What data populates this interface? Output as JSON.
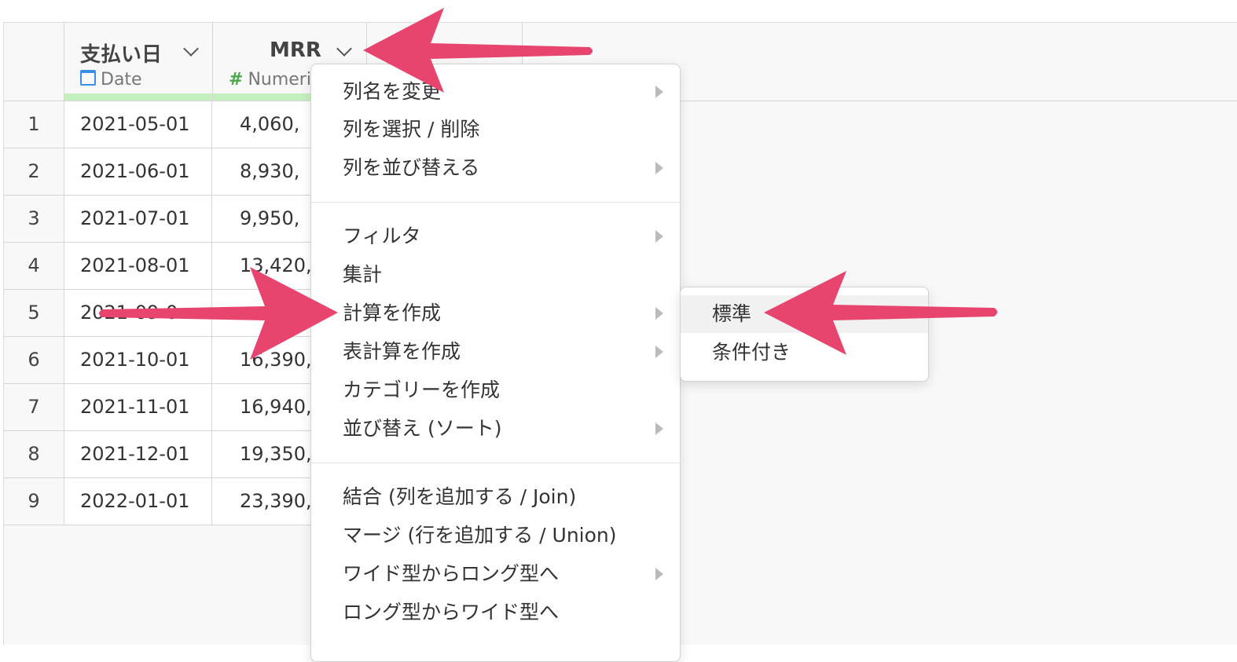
{
  "columns": [
    {
      "name": "支払い日",
      "type": "Date"
    },
    {
      "name": "MRR",
      "type": "Numeric"
    }
  ],
  "rows": [
    {
      "num": "1",
      "date": "2021-05-01",
      "mrr": "4,060,"
    },
    {
      "num": "2",
      "date": "2021-06-01",
      "mrr": "8,930,"
    },
    {
      "num": "3",
      "date": "2021-07-01",
      "mrr": "9,950,"
    },
    {
      "num": "4",
      "date": "2021-08-01",
      "mrr": "13,420,"
    },
    {
      "num": "5",
      "date": "2021-09-0",
      "mrr": ""
    },
    {
      "num": "6",
      "date": "2021-10-01",
      "mrr": "16,390,"
    },
    {
      "num": "7",
      "date": "2021-11-01",
      "mrr": "16,940,"
    },
    {
      "num": "8",
      "date": "2021-12-01",
      "mrr": "19,350,"
    },
    {
      "num": "9",
      "date": "2022-01-01",
      "mrr": "23,390,"
    }
  ],
  "context_menu": {
    "items": [
      {
        "label": "列名を変更",
        "submenu": true
      },
      {
        "label": "列を選択 / 削除",
        "submenu": false
      },
      {
        "label": "列を並び替える",
        "submenu": true
      },
      {
        "label": "フィルタ",
        "submenu": true
      },
      {
        "label": "集計",
        "submenu": false
      },
      {
        "label": "計算を作成",
        "submenu": true
      },
      {
        "label": "表計算を作成",
        "submenu": true
      },
      {
        "label": "カテゴリーを作成",
        "submenu": false
      },
      {
        "label": "並び替え (ソート)",
        "submenu": true
      },
      {
        "label": "結合 (列を追加する / Join)",
        "submenu": false
      },
      {
        "label": "マージ (行を追加する / Union)",
        "submenu": false
      },
      {
        "label": "ワイド型からロング型へ",
        "submenu": true
      },
      {
        "label": "ロング型からワイド型へ",
        "submenu": false
      }
    ]
  },
  "submenu": {
    "items": [
      {
        "label": "標準",
        "highlighted": true
      },
      {
        "label": "条件付き",
        "highlighted": false
      }
    ]
  },
  "colors": {
    "annotation_arrow": "#e8456e",
    "date_type_bar": "#c4f0bf",
    "date_icon": "#3a8ee6",
    "numeric_icon": "#4aa84a"
  }
}
